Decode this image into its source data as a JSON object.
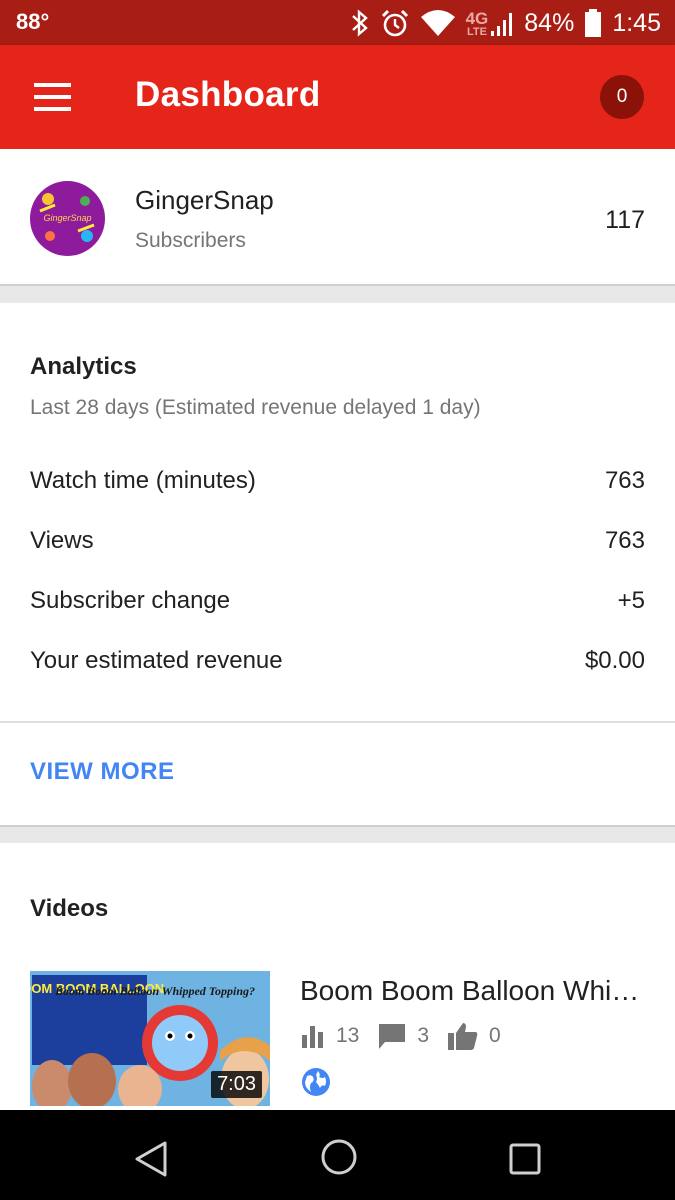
{
  "status_bar": {
    "temperature": "88°",
    "network": "4G",
    "network_sub": "LTE",
    "battery": "84%",
    "time": "1:45"
  },
  "app_bar": {
    "title": "Dashboard",
    "notification_count": "0"
  },
  "channel": {
    "name": "GingerSnap",
    "subscribers_label": "Subscribers",
    "subscriber_count": "117",
    "avatar_text": "GingerSnap"
  },
  "analytics": {
    "title": "Analytics",
    "subtitle": "Last 28 days (Estimated revenue delayed 1 day)",
    "metrics": [
      {
        "label": "Watch time (minutes)",
        "value": "763"
      },
      {
        "label": "Views",
        "value": "763"
      },
      {
        "label": "Subscriber change",
        "value": "+5"
      },
      {
        "label": "Your estimated revenue",
        "value": "$0.00"
      }
    ],
    "view_more": "VIEW MORE"
  },
  "videos": {
    "title": "Videos",
    "items": [
      {
        "title": "Boom Boom Balloon Whipped Topping?",
        "duration": "7:03",
        "views": "13",
        "comments": "3",
        "likes": "0",
        "thumb_brand": "BOOM BOOM BALLOON",
        "thumb_caption": "Boom Boom Balloon Whipped Topping?",
        "visibility_icon": "public-globe-icon"
      }
    ]
  },
  "colors": {
    "status_bar": "#a81d14",
    "app_bar": "#e52519",
    "accent": "#4285f4"
  }
}
